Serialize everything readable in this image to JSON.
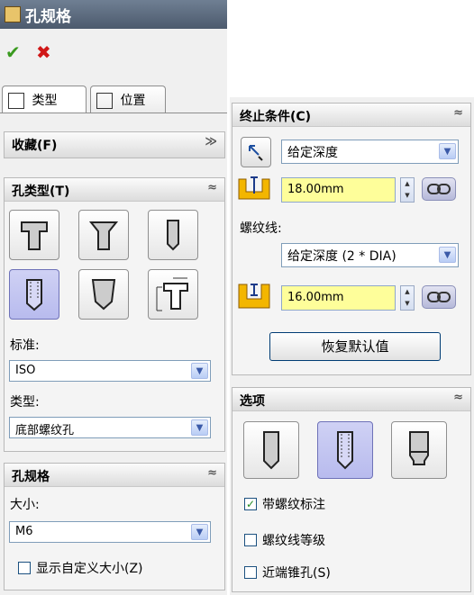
{
  "left_panel": {
    "title": "孔规格",
    "ok_label": "✔",
    "cancel_label": "✖",
    "tabs": [
      {
        "label": "类型"
      },
      {
        "label": "位置"
      }
    ],
    "favorites": {
      "title": "收藏(F)"
    },
    "hole_type": {
      "title": "孔类型(T)",
      "types": [
        "counterbore",
        "countersink",
        "hole",
        "tapped-hole",
        "pipe-tap",
        "legacy"
      ],
      "selected_index": 3,
      "standard_label": "标准:",
      "standard_value": "ISO",
      "type_label": "类型:",
      "type_value": "底部螺纹孔"
    },
    "hole_spec": {
      "title": "孔规格",
      "size_label": "大小:",
      "size_value": "M6",
      "show_custom_label": "显示自定义大小(Z)"
    }
  },
  "right_panel": {
    "end_condition": {
      "title": "终止条件(C)",
      "condition_value": "给定深度",
      "depth_value": "18.00mm",
      "thread_label": "螺纹线:",
      "thread_condition_value": "给定深度 (2 * DIA)",
      "thread_depth_value": "16.00mm",
      "restore_defaults_label": "恢复默认值"
    },
    "options": {
      "title": "选项",
      "cosmetic_thread_label": "带螺纹标注",
      "cosmetic_thread_checked": true,
      "thread_class_label": "螺纹线等级",
      "thread_class_checked": false,
      "near_side_csk_label": "近端锥孔(S)",
      "near_side_csk_checked": false
    }
  }
}
